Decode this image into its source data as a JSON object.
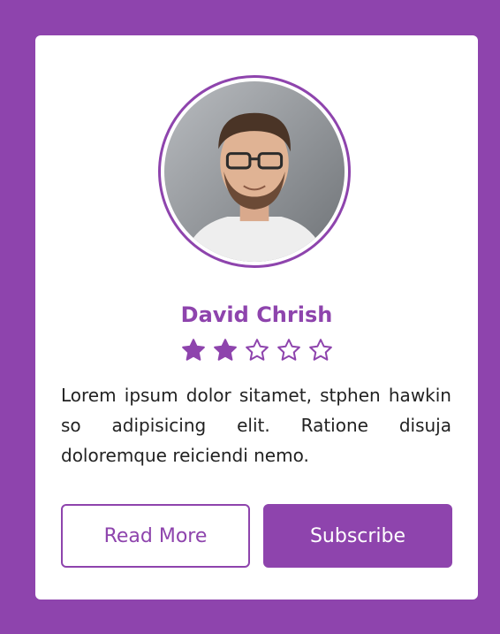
{
  "profile": {
    "name": "David Chrish",
    "rating": 2,
    "rating_max": 5,
    "description": "Lorem ipsum dolor sitamet, stphen hawkin so adipisicing elit. Ratione disuja doloremque reiciendi nemo."
  },
  "actions": {
    "read_more_label": "Read More",
    "subscribe_label": "Subscribe"
  },
  "colors": {
    "accent": "#8e44ad",
    "card_background": "#ffffff",
    "text": "#222222"
  },
  "icons": {
    "star_filled": "star-filled-icon",
    "star_empty": "star-empty-icon"
  }
}
